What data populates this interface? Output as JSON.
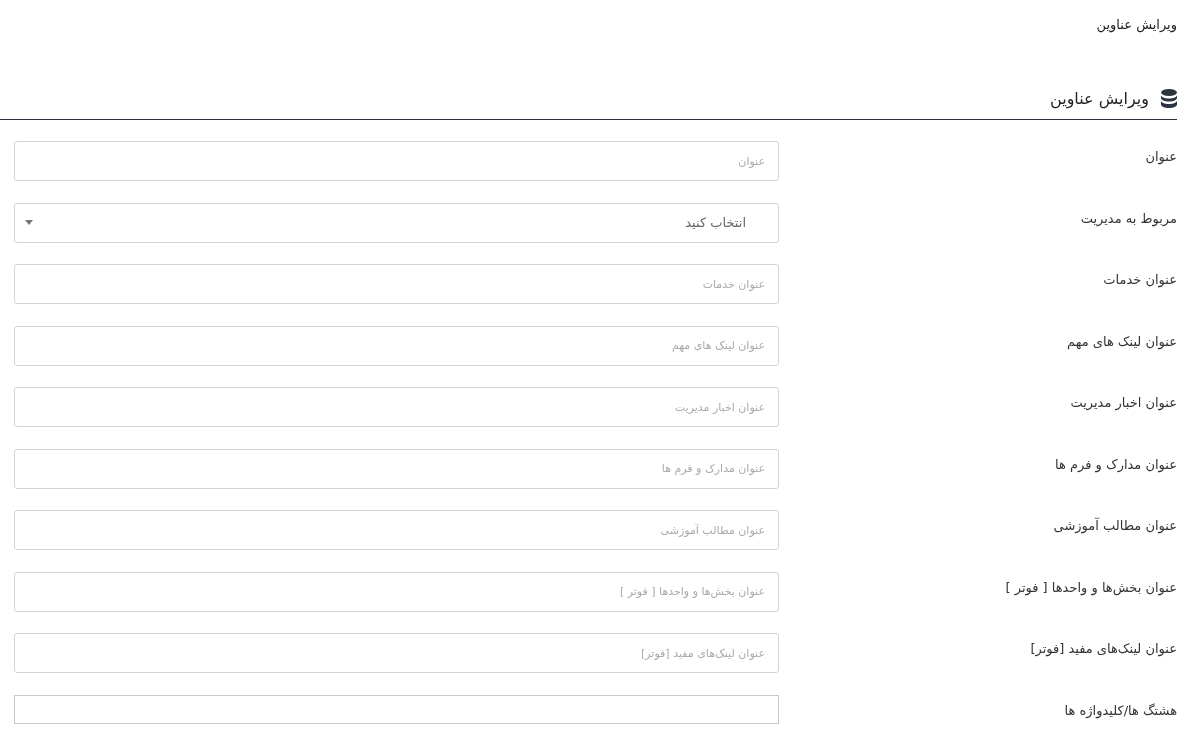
{
  "breadcrumb": "ویرایش عناوین",
  "section": {
    "title": "ویرایش عناوین"
  },
  "fields": [
    {
      "kind": "text",
      "label": "عنوان",
      "placeholder": "عنوان"
    },
    {
      "kind": "select",
      "label": "مربوط به مدیریت",
      "value": "انتخاب کنید"
    },
    {
      "kind": "text",
      "label": "عنوان خدمات",
      "placeholder": "عنوان خدمات"
    },
    {
      "kind": "text",
      "label": "عنوان لینک های مهم",
      "placeholder": "عنوان لینک های مهم"
    },
    {
      "kind": "text",
      "label": "عنوان اخبار مدیریت",
      "placeholder": "عنوان اخبار مدیریت"
    },
    {
      "kind": "text",
      "label": "عنوان مدارک و فرم ها",
      "placeholder": "عنوان مدارک و فرم ها"
    },
    {
      "kind": "text",
      "label": "عنوان مطالب آموزشی",
      "placeholder": "عنوان مطالب آموزشی"
    },
    {
      "kind": "text",
      "label": "عنوان بخش‌ها و واحدها [ فوتر ]",
      "placeholder": "عنوان بخش‌ها و واحدها [ فوتر ]"
    },
    {
      "kind": "text",
      "label": "عنوان لینک‌های مفید [فوتر]",
      "placeholder": "عنوان لینک‌های مفید [فوتر]"
    },
    {
      "kind": "tags",
      "label": "هشتگ ها/کلیدواژه ها"
    }
  ]
}
